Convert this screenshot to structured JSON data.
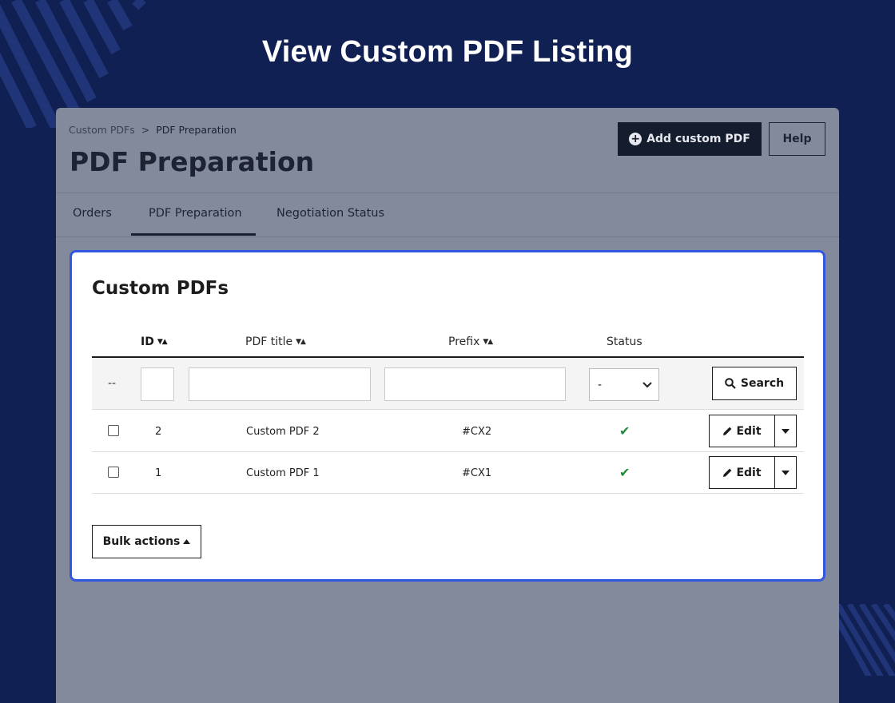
{
  "hero": {
    "title": "View Custom PDF Listing"
  },
  "breadcrumb": {
    "parent": "Custom PDFs",
    "separator": ">",
    "current": "PDF Preparation"
  },
  "page_title": "PDF Preparation",
  "toolbar": {
    "add_label": "Add custom PDF",
    "help_label": "Help",
    "add_icon": "plus-circle-icon"
  },
  "tabs": [
    {
      "label": "Orders",
      "active": false
    },
    {
      "label": "PDF Preparation",
      "active": true
    },
    {
      "label": "Negotiation Status",
      "active": false
    }
  ],
  "card": {
    "title": "Custom PDFs",
    "columns": {
      "id": "ID",
      "title": "PDF title",
      "prefix": "Prefix",
      "status": "Status"
    },
    "filter": {
      "dash": "--",
      "status_value": "-",
      "search_label": "Search"
    },
    "rows": [
      {
        "id": "2",
        "title": "Custom PDF 2",
        "prefix": "#CX2",
        "status": "enabled"
      },
      {
        "id": "1",
        "title": "Custom PDF 1",
        "prefix": "#CX1",
        "status": "enabled"
      }
    ],
    "edit_label": "Edit",
    "bulk_label": "Bulk actions"
  },
  "colors": {
    "background": "#112052",
    "frame": "#838a9c",
    "accent_border": "#3157e0",
    "status_ok": "#1e8a3a"
  }
}
